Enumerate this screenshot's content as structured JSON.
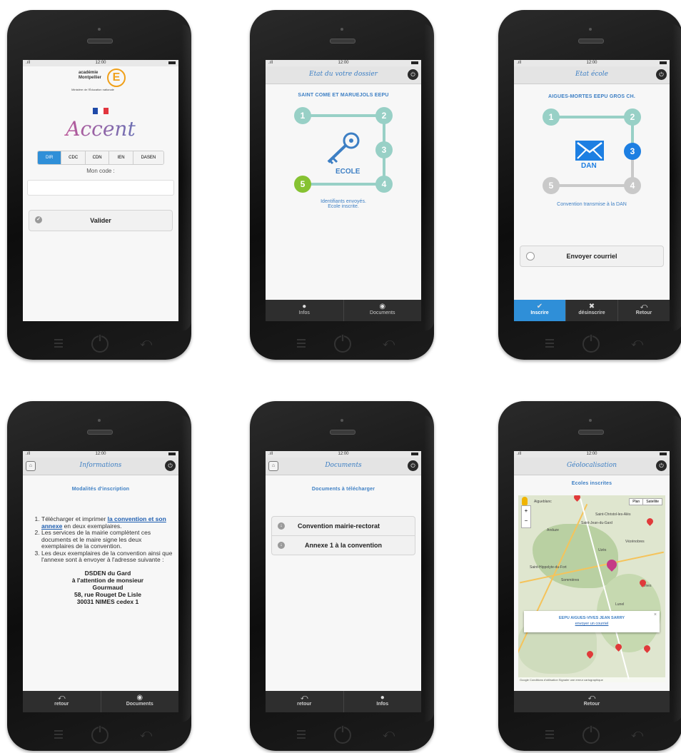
{
  "phones": {
    "login": {
      "status_time": "12:00",
      "academy_line1": "académie",
      "academy_line2": "Montpellier",
      "academy_letter": "E",
      "academy_sub": "Ministère de l'Éducation nationale",
      "app_name": "Accent",
      "roles": [
        "DIR",
        "CDC",
        "CDN",
        "IEN",
        "DASEN"
      ],
      "code_label": "Mon code :",
      "code_value": "",
      "submit_label": "Valider"
    },
    "state_school": {
      "status_time": "12:00",
      "header_title": "Etat du votre dossier",
      "school_name": "SAINT COME ET MARUEJOLS EEPU",
      "steps": [
        "1",
        "2",
        "3",
        "4",
        "5"
      ],
      "center_label": "ECOLE",
      "status_text_1": "Identifiants envoyés.",
      "status_text_2": "Ecole inscrite.",
      "footer": [
        "Infos",
        "Documents"
      ]
    },
    "state_dan": {
      "status_time": "12:00",
      "header_title": "Etat école",
      "school_name": "AIGUES-MORTES EEPU GROS CH.",
      "steps": [
        "1",
        "2",
        "3",
        "4",
        "5"
      ],
      "center_label": "DAN",
      "status_text": "Convention transmise à la DAN",
      "mail_button": "Envoyer courriel",
      "footer": [
        "Inscrire",
        "désinscrire",
        "Retour"
      ]
    },
    "info": {
      "status_time": "12:00",
      "header_title": "Informations",
      "section_title": "Modalités d'inscription",
      "step1_prefix": "Télécharger et imprimer ",
      "step1_link": "la convention et son annexe",
      "step1_suffix": " en deux exemplaires.",
      "step2": "Les services de la mairie complètent ces documents et le maire signe les deux exemplaires de la convention.",
      "step3": "Les deux exemplaires de la convention ainsi que l'annexe sont à envoyer à l'adresse suivante :",
      "address": [
        "DSDEN du Gard",
        "à l'attention de monsieur",
        "Gourmaud",
        "58, rue Rouget De Lisle",
        "30031 NIMES cedex 1"
      ],
      "footer": [
        "retour",
        "Documents"
      ]
    },
    "docs": {
      "status_time": "12:00",
      "header_title": "Documents",
      "section_title": "Documents à télécharger",
      "documents": [
        "Convention mairie-rectorat",
        "Annexe 1 à la convention"
      ],
      "footer": [
        "retour",
        "Infos"
      ]
    },
    "map": {
      "status_time": "12:00",
      "header_title": "Géolocalisation",
      "section_title": "Ecoles inscrites",
      "map_type": [
        "Plan",
        "Satellite"
      ],
      "towns": [
        "Aigueblanc",
        "Saint-Christol-les-Alès",
        "Saint-Jean-du-Gard",
        "Anduze",
        "Vézénobres",
        "Uzès",
        "Saint-Hippolyte-du-Fort",
        "Sommières",
        "Lunel",
        "Nîmes"
      ],
      "popup_title": "EEPU AIGUES-VIVES JEAN SARRY",
      "popup_link": "envoyer un courriel",
      "attribution": "Google   Conditions d'utilisation   Signaler une erreur cartographique",
      "footer": [
        "Retour"
      ]
    }
  }
}
